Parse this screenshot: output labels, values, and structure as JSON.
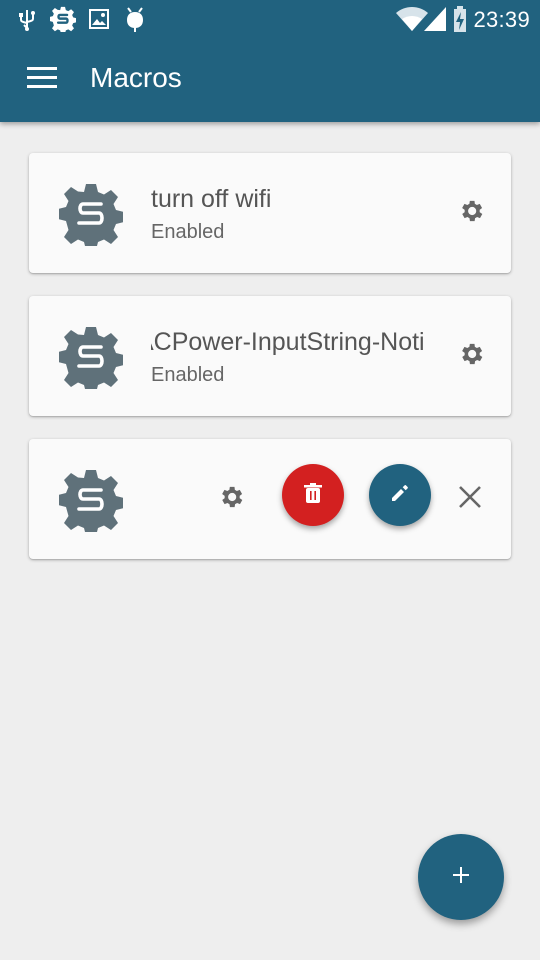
{
  "status_bar": {
    "time": "23:39",
    "left_icons": [
      "usb-icon",
      "macrodroid-notification-icon",
      "image-icon",
      "android-debug-icon"
    ],
    "right_icons": [
      "wifi-icon",
      "cellular-signal-icon",
      "battery-charging-icon"
    ]
  },
  "toolbar": {
    "title": "Macros",
    "menu_icon": "hamburger-menu-icon"
  },
  "macros": [
    {
      "name": "turn off wifi",
      "status": "Enabled",
      "icon": "macro-gear-icon"
    },
    {
      "name": "ACPower-InputString-Noti",
      "status": "Enabled",
      "icon": "macro-gear-icon"
    },
    {
      "name": "",
      "status": "",
      "icon": "macro-gear-icon",
      "actions": [
        "settings-icon",
        "delete-icon",
        "edit-icon",
        "close-icon"
      ]
    }
  ],
  "fab": {
    "label": "+",
    "icon": "add-icon"
  },
  "colors": {
    "primary": "#21627f",
    "background": "#eeeeee",
    "card": "#fafafa",
    "delete": "#d32020",
    "icon_grey": "#616161",
    "macro_icon": "#546e7a"
  }
}
